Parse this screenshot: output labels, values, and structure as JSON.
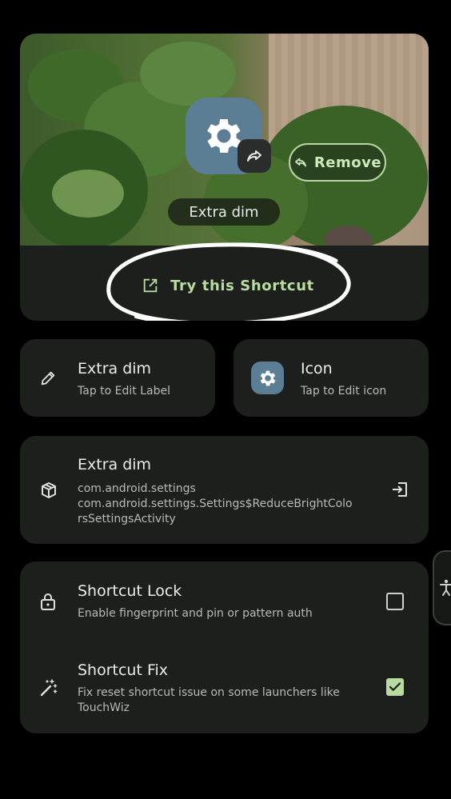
{
  "preview": {
    "app_icon": "gear-icon",
    "badge_icon": "share-arrow-icon",
    "remove_label": "Remove",
    "shortcut_name": "Extra dim",
    "try_label": "Try this Shortcut"
  },
  "edit_label": {
    "title": "Extra dim",
    "subtitle": "Tap to Edit Label",
    "icon": "pencil-icon"
  },
  "edit_icon": {
    "title": "Icon",
    "subtitle": "Tap to Edit icon",
    "icon": "gear-icon"
  },
  "intent": {
    "title": "Extra dim",
    "package": "com.android.settings",
    "activity_line1": "com.android.settings.Settings$ReduceBrightColo",
    "activity_line2": "rsSettingsActivity",
    "icon": "cube-icon",
    "action_icon": "open-exit-icon"
  },
  "options": {
    "lock": {
      "title": "Shortcut Lock",
      "subtitle": "Enable fingerprint and pin or pattern auth",
      "checked": false,
      "icon": "lock-icon"
    },
    "fix": {
      "title": "Shortcut Fix",
      "subtitle_line1": "Fix reset shortcut issue on some launchers like",
      "subtitle_line2": "TouchWiz",
      "checked": true,
      "icon": "magic-wand-icon"
    }
  },
  "colors": {
    "accent": "#b8dca0",
    "card": "#1d1f1c",
    "icon_bg": "#5c7e94"
  }
}
